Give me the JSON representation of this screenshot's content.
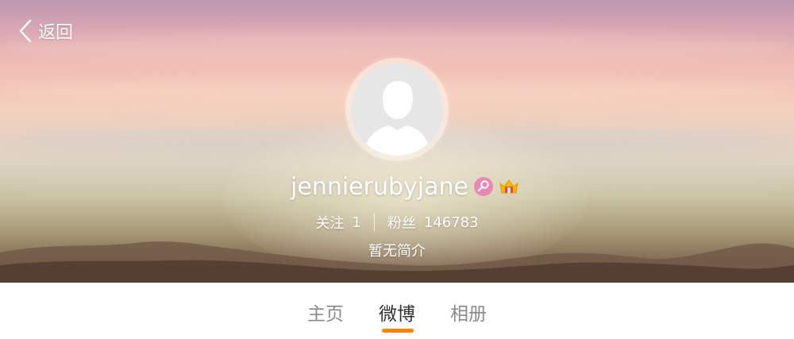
{
  "header": {
    "back_label": "返回"
  },
  "profile": {
    "username": "jennierubyjane",
    "badges": [
      "vip-badge-icon",
      "crown-badge-icon"
    ],
    "following_label": "关注",
    "following_count": "1",
    "followers_label": "粉丝",
    "followers_count": "146783",
    "bio": "暂无简介"
  },
  "tabs": [
    {
      "label": "主页",
      "active": false
    },
    {
      "label": "微博",
      "active": true
    },
    {
      "label": "相册",
      "active": false
    }
  ],
  "colors": {
    "accent": "#ff8200",
    "active_tab_text": "#333333",
    "inactive_tab_text": "#8a8a8a",
    "vip_badge": "#e889b4",
    "crown_badge": "#f5b800"
  }
}
